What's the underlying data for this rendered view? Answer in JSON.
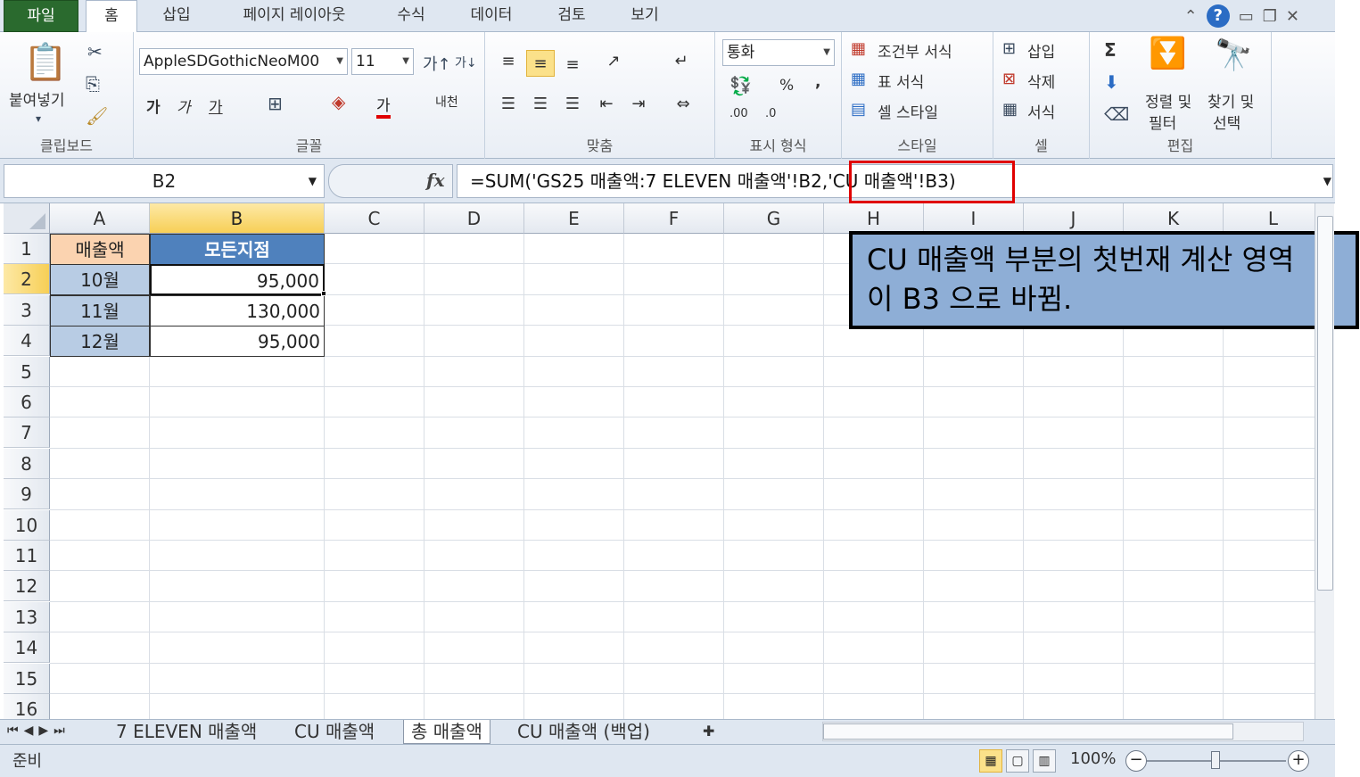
{
  "ribbon_tabs": [
    {
      "label": "파일"
    },
    {
      "label": "홈"
    },
    {
      "label": "삽입"
    },
    {
      "label": "페이지 레이아웃"
    },
    {
      "label": "수식"
    },
    {
      "label": "데이터"
    },
    {
      "label": "검토"
    },
    {
      "label": "보기"
    }
  ],
  "clipboard": {
    "paste_label": "붙여넣기",
    "group_label": "클립보드"
  },
  "font": {
    "name": "AppleSDGothicNeoM00",
    "size": "11",
    "group_label": "글꼴",
    "bold": "가",
    "italic": "가",
    "underline": "가",
    "color_glyph": "가",
    "phonetic": "내천"
  },
  "alignment": {
    "group_label": "맞춤"
  },
  "number": {
    "format": "통화",
    "percent": "%",
    "comma": ",",
    "group_label": "표시 형식",
    "inc_decimal": ".00",
    "dec_decimal": ".0"
  },
  "styles": {
    "conditional": "조건부 서식",
    "table_format": "표 서식",
    "cell_styles": "셀 스타일",
    "group_label": "스타일"
  },
  "cells": {
    "insert": "삽입",
    "delete": "삭제",
    "format": "서식",
    "group_label": "셀"
  },
  "editing": {
    "sort_filter_1": "정렬 및",
    "sort_filter_2": "필터",
    "find_select_1": "찾기 및",
    "find_select_2": "선택",
    "group_label": "편집",
    "sum_glyph": "Σ"
  },
  "formula_bar": {
    "name_box": "B2",
    "fx": "fx",
    "formula": "=SUM('GS25 매출액:7 ELEVEN 매출액'!B2,'CU 매출액'!B3)"
  },
  "columns": [
    "A",
    "B",
    "C",
    "D",
    "E",
    "F",
    "G",
    "H",
    "I",
    "J",
    "K",
    "L"
  ],
  "rows": [
    "1",
    "2",
    "3",
    "4",
    "5",
    "6",
    "7",
    "8",
    "9",
    "10",
    "11",
    "12",
    "13",
    "14",
    "15",
    "16"
  ],
  "table": {
    "header_a": "매출액",
    "header_b": "모든지점",
    "rows": [
      {
        "month": "10월",
        "value": "95,000"
      },
      {
        "month": "11월",
        "value": "130,000"
      },
      {
        "month": "12월",
        "value": "95,000"
      }
    ]
  },
  "callout": {
    "line1": "CU 매출액 부분의 첫번재 계산 영역",
    "line2": "이 B3 으로 바뀜."
  },
  "sheet_tabs": [
    {
      "label": "7 ELEVEN 매출액"
    },
    {
      "label": "CU 매출액"
    },
    {
      "label": "총 매출액"
    },
    {
      "label": "CU 매출액 (백업)"
    }
  ],
  "status": {
    "mode": "준비",
    "zoom": "100%"
  },
  "colors": {
    "file_tab": "#2a6a2e",
    "header_a": "#fbd3b0",
    "header_b": "#4f81bd",
    "month_cells": "#b8cce4",
    "callout": "#8eaed6",
    "highlight": "#e00000"
  }
}
